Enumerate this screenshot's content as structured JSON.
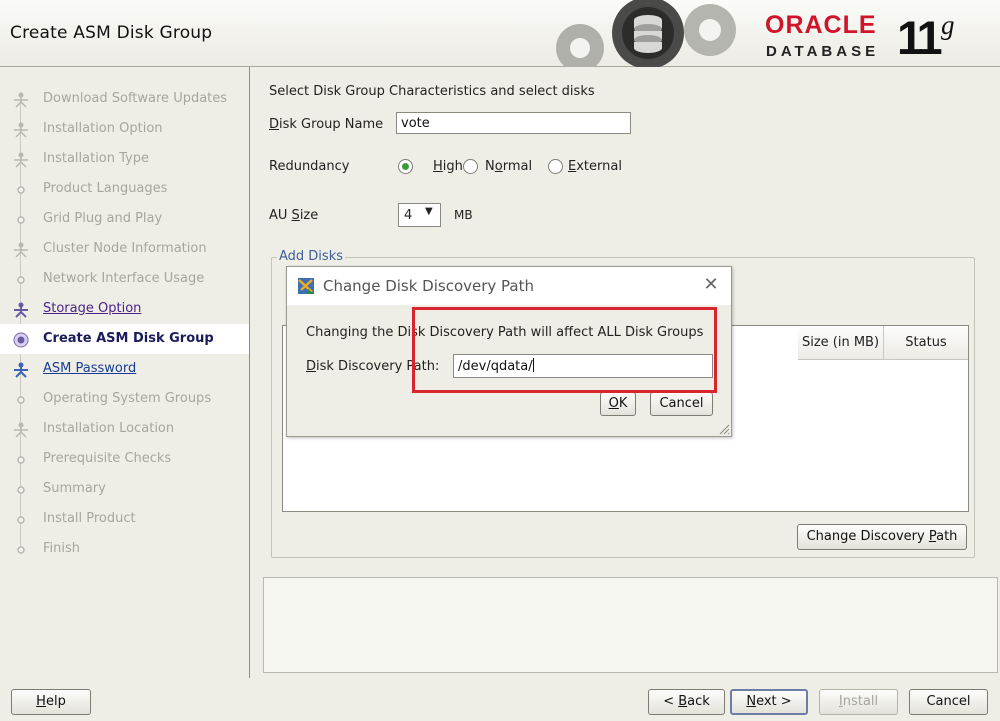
{
  "header": {
    "title": "Create ASM Disk Group",
    "logo_oracle": "ORACLE",
    "logo_database": "DATABASE",
    "logo_version": "11",
    "logo_version_sup": "g"
  },
  "sidebar": {
    "items": [
      {
        "label": "Download Software Updates",
        "state": "done"
      },
      {
        "label": "Installation Option",
        "state": "done"
      },
      {
        "label": "Installation Type",
        "state": "done"
      },
      {
        "label": "Product Languages",
        "state": "done"
      },
      {
        "label": "Grid Plug and Play",
        "state": "done"
      },
      {
        "label": "Cluster Node Information",
        "state": "done"
      },
      {
        "label": "Network Interface Usage",
        "state": "done"
      },
      {
        "label": "Storage Option",
        "state": "visited"
      },
      {
        "label": "Create ASM Disk Group",
        "state": "current"
      },
      {
        "label": "ASM Password",
        "state": "next"
      },
      {
        "label": "Operating System Groups",
        "state": "pending"
      },
      {
        "label": "Installation Location",
        "state": "pending"
      },
      {
        "label": "Prerequisite Checks",
        "state": "pending"
      },
      {
        "label": "Summary",
        "state": "pending"
      },
      {
        "label": "Install Product",
        "state": "pending"
      },
      {
        "label": "Finish",
        "state": "pending"
      }
    ]
  },
  "main": {
    "intro": "Select Disk Group Characteristics and select disks",
    "disk_group_name_label_mn": "D",
    "disk_group_name_label_rest": "isk Group Name",
    "disk_group_name_value": "vote",
    "redundancy_label": "Redundancy",
    "redundancy_options": [
      {
        "label": "High",
        "mnemonic": "H",
        "selected": true
      },
      {
        "label": "Normal",
        "mnemonic": "o",
        "selected": false
      },
      {
        "label": "External",
        "mnemonic": "E",
        "selected": false
      }
    ],
    "au_size_label_pre": "AU ",
    "au_size_label_mn": "S",
    "au_size_label_post": "ize",
    "au_size_value": "4",
    "au_size_unit": "MB",
    "add_disks_legend": "Add Disks",
    "table_headers": {
      "size": "Size (in MB)",
      "status": "Status"
    },
    "change_discovery_path_pre": "Change Discovery ",
    "change_discovery_path_mn": "P",
    "change_discovery_path_post": "ath"
  },
  "dialog": {
    "title": "Change Disk Discovery Path",
    "message": "Changing the Disk Discovery Path will affect ALL Disk Groups",
    "path_label_pre": "D",
    "path_label_post": "isk Discovery Path:",
    "path_value": "/dev/qdata/",
    "ok_mn": "O",
    "ok_rest": "K",
    "cancel_label": "Cancel",
    "highlight_color": "#d9252e"
  },
  "bottom": {
    "help_mn": "H",
    "help_rest": "elp",
    "back_pre": "< ",
    "back_mn": "B",
    "back_rest": "ack",
    "next_mn": "N",
    "next_rest": "ext >",
    "install_mn": "I",
    "install_rest": "nstall",
    "cancel_label": "Cancel"
  },
  "colors": {
    "oracle_red": "#d0152a",
    "visited_link": "#4b2486",
    "next_link": "#1a3c93"
  }
}
